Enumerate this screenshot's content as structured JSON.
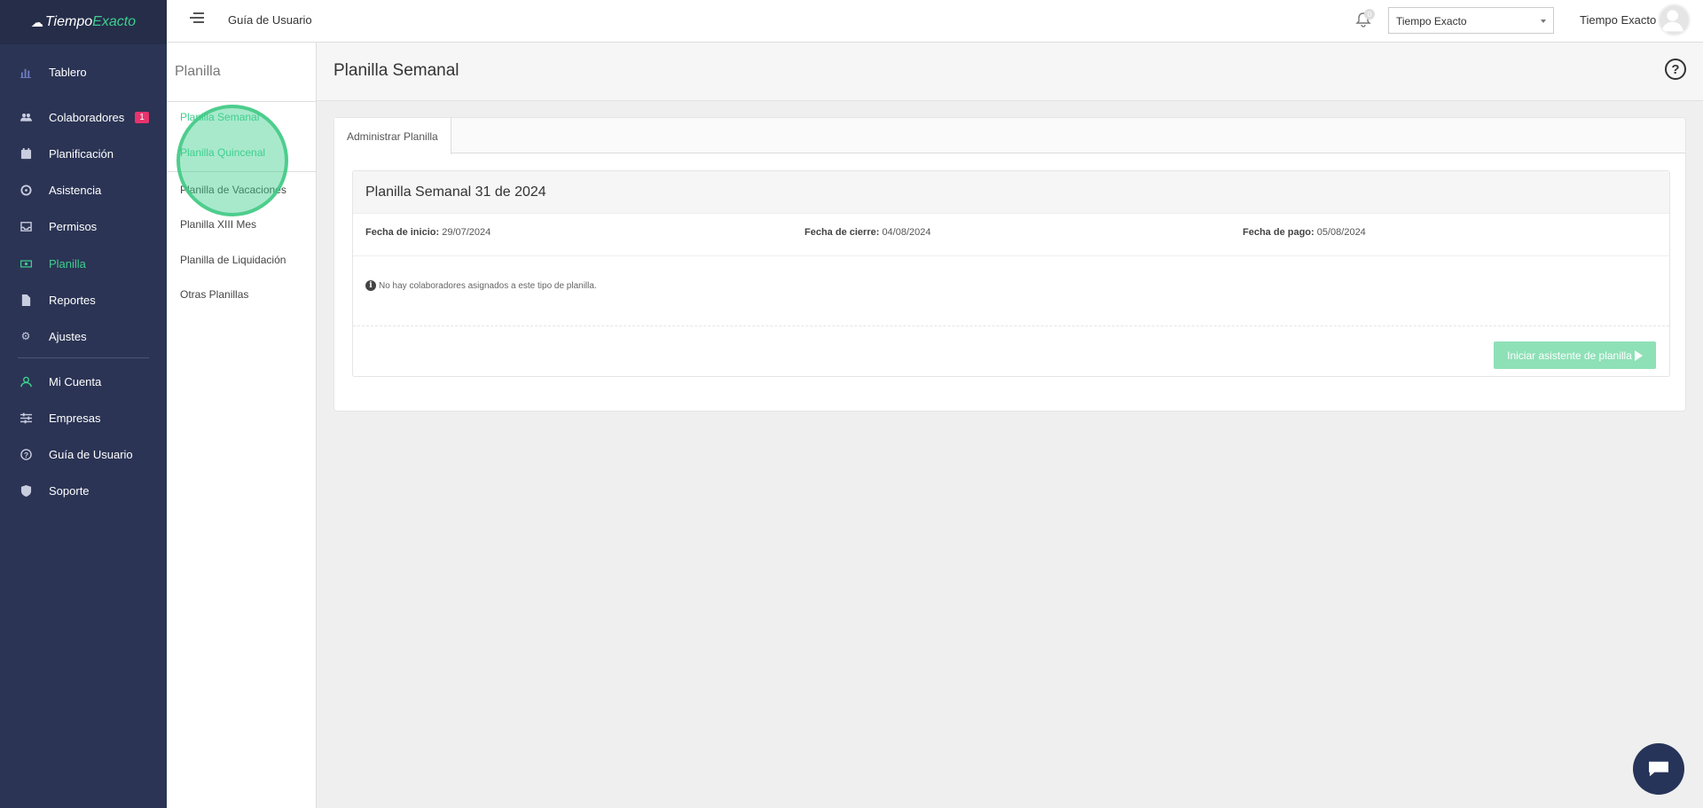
{
  "app": {
    "logo_part1": "Tiempo",
    "logo_part2": "Exacto",
    "brand_color": "#3ecf8e",
    "sidebar_color": "#2b3454"
  },
  "sidebar": {
    "items": [
      {
        "label": "Tablero",
        "icon": "bar-chart-icon"
      },
      {
        "label": "Colaboradores",
        "icon": "users-icon",
        "badge": "1"
      },
      {
        "label": "Planificación",
        "icon": "calendar-icon"
      },
      {
        "label": "Asistencia",
        "icon": "clock-icon"
      },
      {
        "label": "Permisos",
        "icon": "inbox-icon"
      },
      {
        "label": "Planilla",
        "icon": "money-icon",
        "active": true
      },
      {
        "label": "Reportes",
        "icon": "file-icon"
      },
      {
        "label": "Ajustes",
        "icon": "gear-icon"
      },
      {
        "label": "Mi Cuenta",
        "icon": "user-icon"
      },
      {
        "label": "Empresas",
        "icon": "sliders-icon"
      },
      {
        "label": "Guía de Usuario",
        "icon": "question-icon"
      },
      {
        "label": "Soporte",
        "icon": "shield-icon"
      }
    ]
  },
  "topbar": {
    "guide_link": "Guía de Usuario",
    "notifications_count": "0",
    "company_select": "Tiempo Exacto",
    "user_name": "Tiempo Exacto"
  },
  "submenu": {
    "title": "Planilla",
    "items": [
      "Planilla Semanal",
      "Planilla Quincenal",
      "Planilla de Vacaciones",
      "Planilla XIII Mes",
      "Planilla de Liquidación",
      "Otras Planillas"
    ]
  },
  "page": {
    "title": "Planilla Semanal",
    "tab": "Administrar Planilla",
    "section_title": "Planilla Semanal 31 de 2024",
    "start_label": "Fecha de inicio:",
    "start_value": "29/07/2024",
    "close_label": "Fecha de cierre:",
    "close_value": "04/08/2024",
    "pay_label": "Fecha de pago:",
    "pay_value": "05/08/2024",
    "notice": "No hay colaboradores asignados a este tipo de planilla.",
    "start_button": "Iniciar asistente de planilla"
  }
}
